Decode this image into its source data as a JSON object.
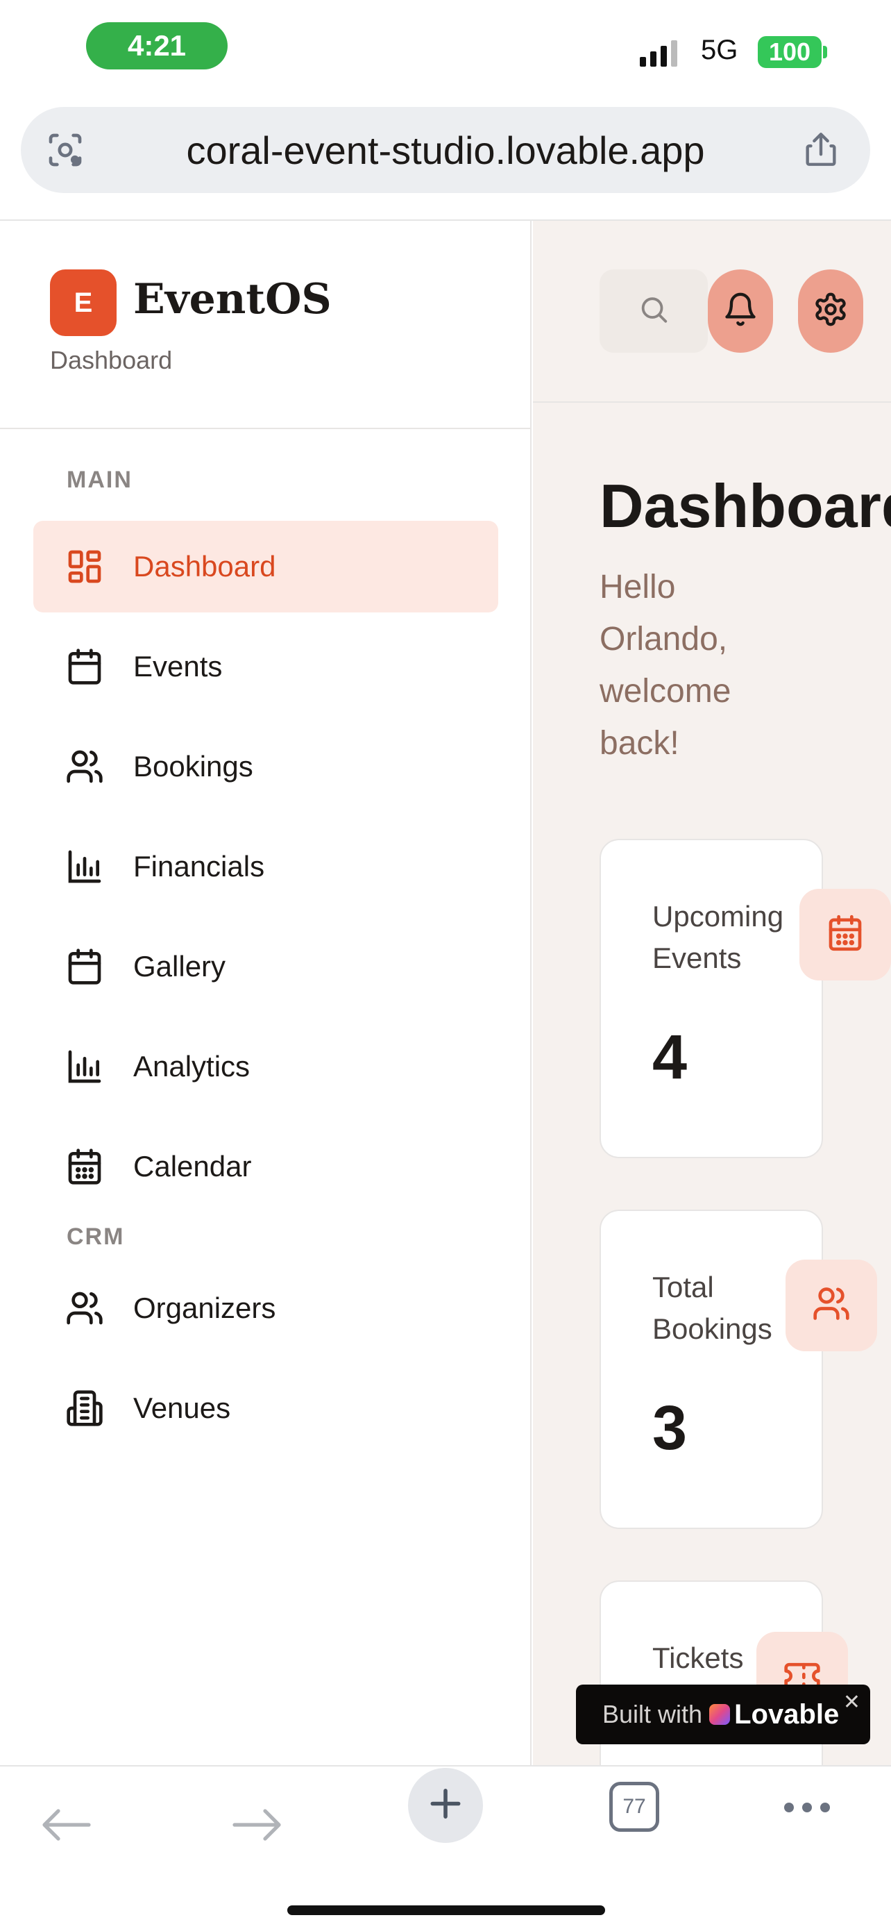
{
  "status_bar": {
    "time": "4:21",
    "network": "5G",
    "battery": "100"
  },
  "browser": {
    "url": "coral-event-studio.lovable.app"
  },
  "sidebar": {
    "logo_letter": "E",
    "brand": "EventOS",
    "subtitle": "Dashboard",
    "sections": [
      {
        "label": "MAIN",
        "items": [
          {
            "label": "Dashboard",
            "icon": "layout-grid-icon",
            "active": true
          },
          {
            "label": "Events",
            "icon": "calendar-icon"
          },
          {
            "label": "Bookings",
            "icon": "users-icon"
          },
          {
            "label": "Financials",
            "icon": "bar-chart-icon"
          },
          {
            "label": "Gallery",
            "icon": "calendar-icon"
          },
          {
            "label": "Analytics",
            "icon": "bar-chart-icon"
          },
          {
            "label": "Calendar",
            "icon": "calendar-days-icon"
          }
        ]
      },
      {
        "label": "CRM",
        "items": [
          {
            "label": "Organizers",
            "icon": "users-icon"
          },
          {
            "label": "Venues",
            "icon": "building-icon"
          }
        ]
      }
    ]
  },
  "main": {
    "title": "Dashboard",
    "welcome": "Hello Orlando, welcome back!",
    "stats": [
      {
        "label": "Upcoming Events",
        "value": "4",
        "icon": "calendar-icon"
      },
      {
        "label": "Total Bookings",
        "value": "3",
        "icon": "users-icon"
      },
      {
        "label": "Tickets",
        "value": "",
        "icon": "ticket-icon"
      }
    ]
  },
  "badge": {
    "built_with": "Built with",
    "brand": "Lovable"
  },
  "toolbar": {
    "tab_count": "77"
  },
  "colors": {
    "accent": "#e5512b",
    "active_bg": "#fde8e2",
    "main_bg": "#f6f1ee",
    "icon_btn": "#eda08e"
  }
}
